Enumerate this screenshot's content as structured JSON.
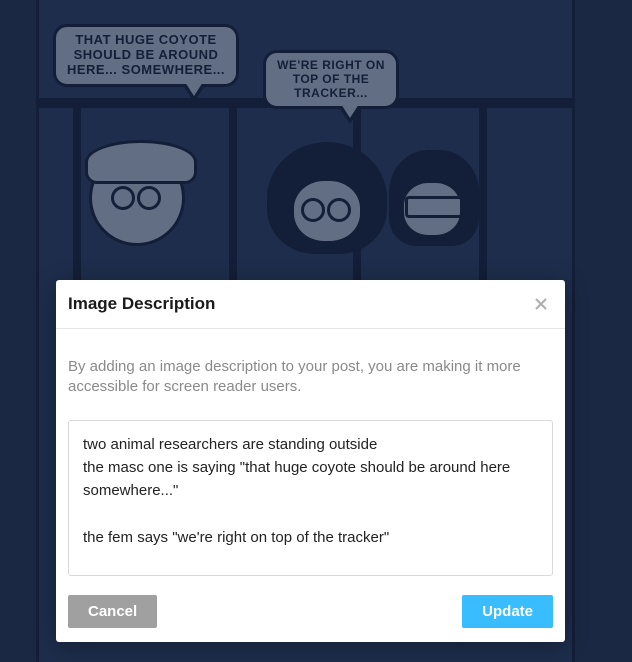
{
  "comic": {
    "speech1": "THAT HUGE COYOTE SHOULD BE AROUND HERE... SOMEWHERE...",
    "speech2": "WE'RE RIGHT ON TOP OF THE TRACKER..."
  },
  "modal": {
    "title": "Image Description",
    "help_text": "By adding an image description to your post, you are making it more accessible for screen reader users.",
    "textarea_value": "two animal researchers are standing outside\nthe masc one is saying \"that huge coyote should be around here somewhere...\"\n\nthe fem says \"we're right on top of the tracker\"",
    "cancel_label": "Cancel",
    "update_label": "Update"
  }
}
